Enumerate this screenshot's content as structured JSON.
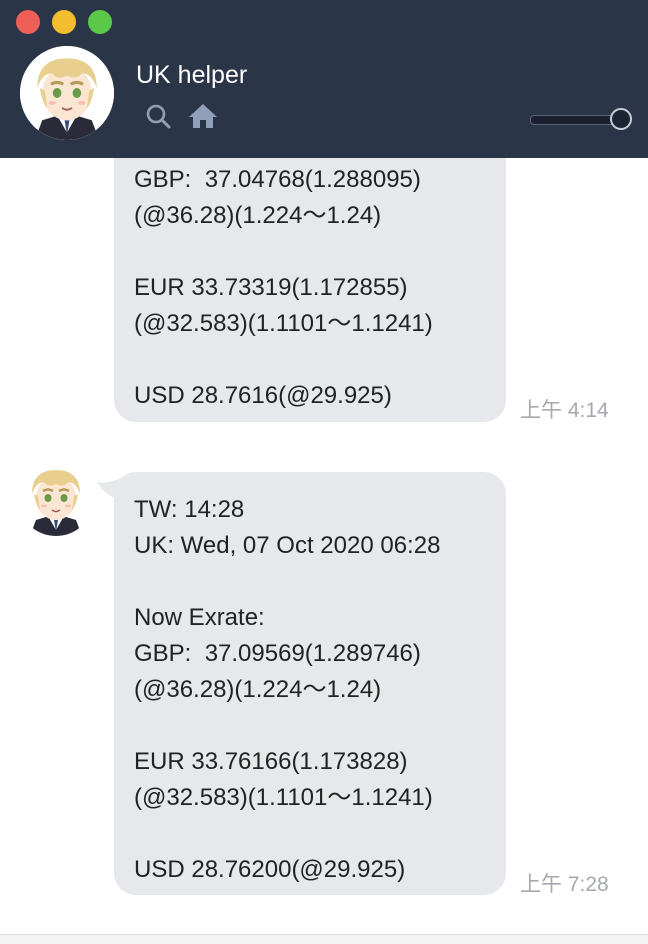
{
  "window": {
    "title": "UK helper"
  },
  "header": {
    "icons": [
      "search-icon",
      "home-icon"
    ],
    "slider_level": 0.9
  },
  "messages": [
    {
      "lines": [
        "GBP:  37.04768(1.288095)",
        "(@36.28)(1.224～1.24)",
        "",
        "EUR 33.73319(1.172855)",
        "(@32.583)(1.1101～1.1241)",
        "",
        "USD 28.7616(@29.925)"
      ],
      "time": "上午 4:14"
    },
    {
      "lines": [
        "TW: 14:28",
        "UK: Wed, 07 Oct 2020 06:28",
        "",
        "Now Exrate:",
        "GBP:  37.09569(1.289746)",
        "(@36.28)(1.224～1.24)",
        "",
        "EUR 33.76166(1.173828)",
        "(@32.583)(1.1101～1.1241)",
        "",
        "USD 28.76200(@29.925)"
      ],
      "time": "上午 7:28"
    }
  ],
  "colors": {
    "header_bg": "#2b3548",
    "bubble_bg": "#e6e8eb",
    "timestamp": "#a5a9af"
  }
}
